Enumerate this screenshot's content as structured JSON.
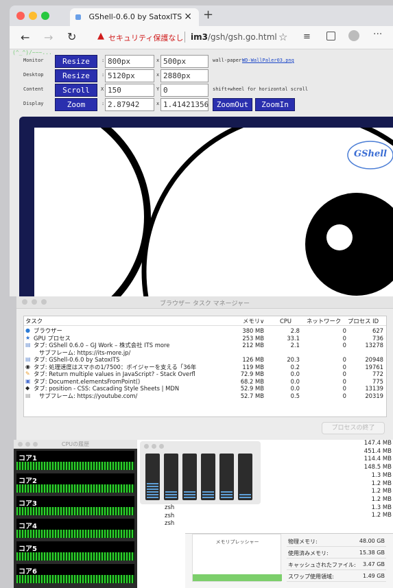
{
  "browser": {
    "tab_title": "GShell-0.6.0 by SatoxITS",
    "tab_close": "×",
    "new_tab": "+",
    "security_text": "セキュリティ保護なし",
    "url_host": "im3",
    "url_path": "/gsh/gsh.go.html"
  },
  "gshell": {
    "kaomoji": "(^_^)/~~~...",
    "rows": [
      {
        "label": "Monitor",
        "button": "Resize",
        "val1": "800px",
        "sep": "x",
        "val2": "500px",
        "note_label": "wall-paper:",
        "note_link": "WD-WallPaler03.png",
        "prefix1": ":"
      },
      {
        "label": "Desktop",
        "button": "Resize",
        "val1": "5120px",
        "sep": "x",
        "val2": "2880px",
        "prefix1": ":"
      },
      {
        "label": "Content",
        "button": "Scroll",
        "val1": "150",
        "sep": "Y",
        "val2": "0",
        "note_plain": "shift+wheel for horizontal scroll",
        "prefix1": "X"
      },
      {
        "label": "Display",
        "button": "Zoom",
        "val1": "2.87942",
        "sep": "x",
        "val2": "1.41421356",
        "prefix1": ":",
        "btn_out": "ZoomOut",
        "btn_in": "ZoomIn"
      }
    ],
    "logo_text": "GShell"
  },
  "task_manager": {
    "title": "ブラウザー タスク マネージャー",
    "headers": {
      "task": "タスク",
      "memory": "メモリ∨",
      "cpu": "CPU",
      "network": "ネットワーク",
      "pid": "プロセス ID"
    },
    "rows": [
      {
        "name": "ブラウザー",
        "memory": "380 MB",
        "cpu": "2.8",
        "network": "0",
        "pid": "627"
      },
      {
        "name": "GPU プロセス",
        "memory": "253 MB",
        "cpu": "33.1",
        "network": "0",
        "pid": "736"
      },
      {
        "name": "タブ: GShell 0.6.0 – GJ Work – 株式会社 ITS more",
        "memory": "212 MB",
        "cpu": "2.1",
        "network": "0",
        "pid": "13278"
      },
      {
        "name": "サブフレーム: https://its-more.jp/",
        "memory": "",
        "cpu": "",
        "network": "",
        "pid": ""
      },
      {
        "name": "タブ: GShell-0.6.0 by SatoxITS",
        "memory": "126 MB",
        "cpu": "20.3",
        "network": "0",
        "pid": "20948"
      },
      {
        "name": "タブ: 処理速度はスマホの1/7500：ボイジャーを支える「36年",
        "memory": "119 MB",
        "cpu": "0.2",
        "network": "0",
        "pid": "19761"
      },
      {
        "name": "タブ: Return multiple values in JavaScript? - Stack Overfl",
        "memory": "72.9 MB",
        "cpu": "0.0",
        "network": "0",
        "pid": "772"
      },
      {
        "name": "タブ: Document.elementsFromPoint()",
        "memory": "68.2 MB",
        "cpu": "0.0",
        "network": "0",
        "pid": "775"
      },
      {
        "name": "タブ: position - CSS: Cascading Style Sheets | MDN",
        "memory": "52.9 MB",
        "cpu": "0.0",
        "network": "0",
        "pid": "13139"
      },
      {
        "name": "サブフレーム: https://youtube.com/",
        "memory": "52.7 MB",
        "cpu": "0.5",
        "network": "0",
        "pid": "20319"
      }
    ],
    "end_process": "プロセスの終了"
  },
  "cpu_history": {
    "title": "CPUの履歴",
    "cores": [
      "コア1",
      "コア2",
      "コア3",
      "コア4",
      "コア5",
      "コア6"
    ]
  },
  "cpu_meter": {
    "levels": [
      0.35,
      0.2,
      0.2,
      0.2,
      0.2,
      0.12
    ]
  },
  "activity_monitor": {
    "sizes": [
      "147.4 MB",
      "451.4 MB",
      "114.4 MB",
      "148.5 MB",
      "1.3 MB",
      "1.2 MB",
      "1.2 MB",
      "1.2 MB",
      "1.3 MB",
      "1.2 MB"
    ],
    "procs": [
      "zsh",
      "zsh",
      "zsh"
    ],
    "memory_pressure_label": "メモリプレッシャー",
    "stats": [
      {
        "label": "物理メモリ:",
        "value": "48.00 GB"
      },
      {
        "label": "使用済みメモリ:",
        "value": "15.38 GB"
      },
      {
        "label": "キャッシュされたファイル:",
        "value": "3.47 GB"
      },
      {
        "label": "スワップ使用領域:",
        "value": "1.49 GB"
      }
    ]
  }
}
